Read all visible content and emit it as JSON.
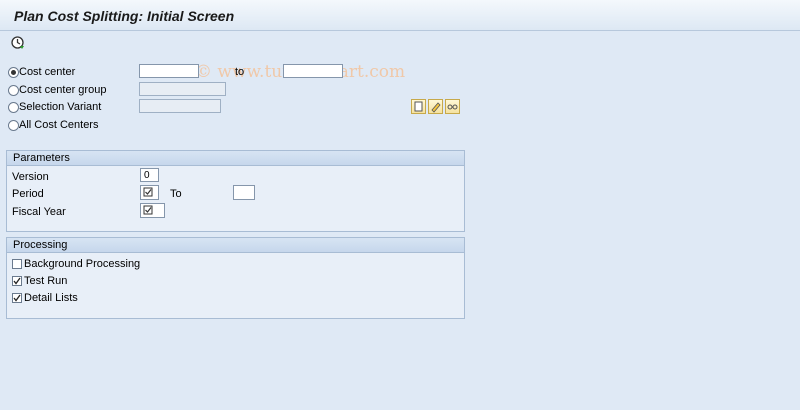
{
  "window": {
    "title": "Plan Cost Splitting: Initial Screen"
  },
  "watermark": "© www.tutorialkart.com",
  "selection": {
    "cost_center_label": "Cost center",
    "to_label": "to",
    "cost_center_group_label": "Cost center group",
    "selection_variant_label": "Selection Variant",
    "all_cost_centers_label": "All Cost Centers",
    "selected": "Cost center"
  },
  "parameters": {
    "header": "Parameters",
    "version_label": "Version",
    "version_value": "0",
    "period_label": "Period",
    "to_label": "To",
    "fiscal_year_label": "Fiscal Year"
  },
  "processing": {
    "header": "Processing",
    "background_label": "Background Processing",
    "background_checked": false,
    "test_run_label": "Test Run",
    "test_run_checked": true,
    "detail_lists_label": "Detail Lists",
    "detail_lists_checked": true
  },
  "icons": [
    "execute-icon",
    "create-variant-icon",
    "edit-variant-icon",
    "display-variant-icon"
  ]
}
